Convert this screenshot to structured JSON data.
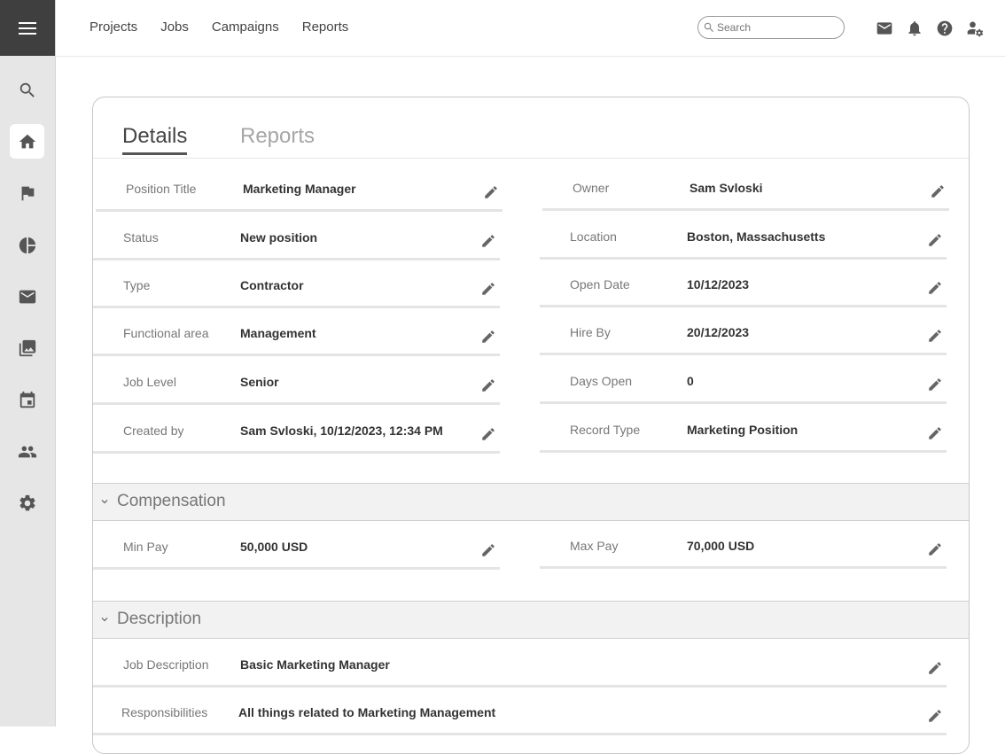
{
  "topnav": [
    "Projects",
    "Jobs",
    "Campaigns",
    "Reports"
  ],
  "search": {
    "placeholder": "Search"
  },
  "tabs": {
    "details": "Details",
    "reports": "Reports"
  },
  "details": {
    "left": [
      {
        "label": "Position Title",
        "value": "Marketing Manager"
      },
      {
        "label": "Status",
        "value": "New position"
      },
      {
        "label": "Type",
        "value": "Contractor"
      },
      {
        "label": "Functional area",
        "value": "Management"
      },
      {
        "label": "Job Level",
        "value": "Senior"
      },
      {
        "label": "Created by",
        "value": "Sam Svloski, 10/12/2023, 12:34 PM"
      }
    ],
    "right": [
      {
        "label": "Owner",
        "value": "Sam Svloski"
      },
      {
        "label": "Location",
        "value": "Boston, Massachusetts"
      },
      {
        "label": "Open Date",
        "value": "10/12/2023"
      },
      {
        "label": "Hire By",
        "value": "20/12/2023"
      },
      {
        "label": "Days Open",
        "value": "0"
      },
      {
        "label": "Record Type",
        "value": "Marketing Position"
      }
    ]
  },
  "compensation": {
    "title": "Compensation",
    "min": {
      "label": "Min Pay",
      "value": "50,000 USD"
    },
    "max": {
      "label": "Max Pay",
      "value": "70,000 USD"
    }
  },
  "description": {
    "title": "Description",
    "job_description": {
      "label": "Job Description",
      "value": "Basic Marketing Manager"
    },
    "responsibilities": {
      "label": "Responsibilities",
      "value": "All things related to Marketing Management"
    }
  }
}
